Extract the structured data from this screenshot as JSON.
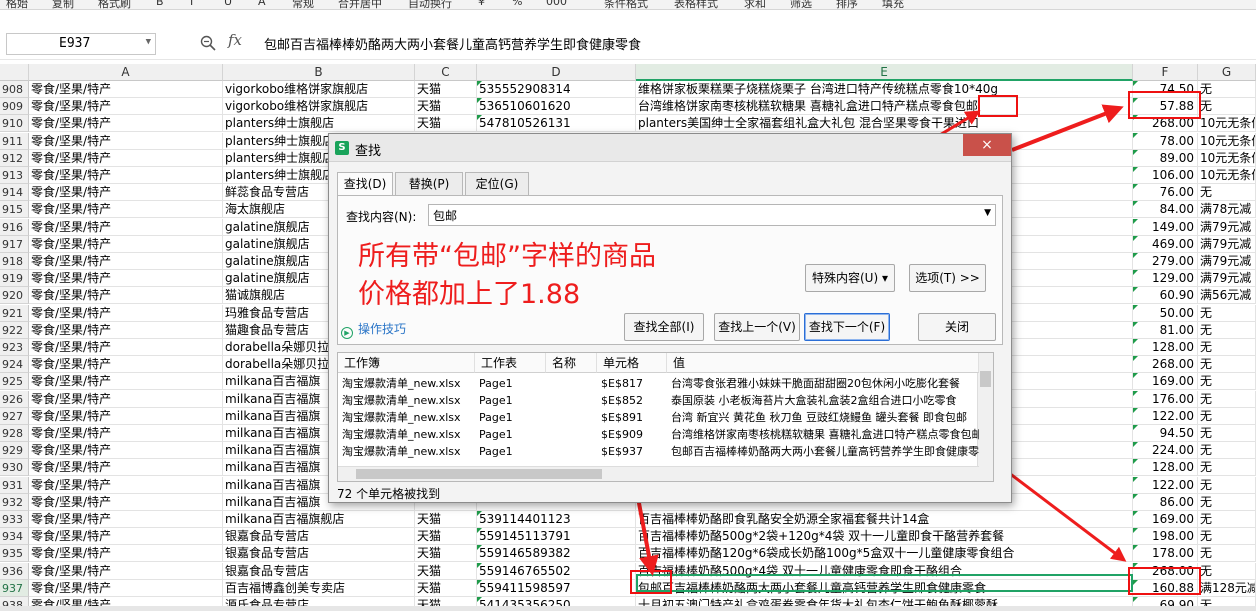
{
  "toolbar": {
    "items": [
      "格始",
      "复制",
      "格式刷",
      "B",
      "I",
      "U",
      "A",
      "常规",
      "合并居中",
      "自动换行",
      "¥",
      "%",
      "000",
      "条件格式",
      "表格样式",
      "求和",
      "筛选",
      "排序",
      "填充"
    ]
  },
  "formula_bar": {
    "name_box": "E937",
    "fx_label": "fx",
    "content": "包邮百吉福棒棒奶酪两大两小套餐儿童高钙营养学生即食健康零食"
  },
  "columns": [
    "A",
    "B",
    "C",
    "D",
    "E",
    "F",
    "G"
  ],
  "rows": [
    {
      "num": "908",
      "a": "零食/坚果/特产",
      "b": "vigorkobo维格饼家旗舰店",
      "c": "天猫",
      "d": "535552908314",
      "e": "维格饼家板栗糕栗子烧糕烧栗子 台湾进口特产传统糕点零食10*40g",
      "f": "74.50",
      "g": "无"
    },
    {
      "num": "909",
      "a": "零食/坚果/特产",
      "b": "vigorkobo维格饼家旗舰店",
      "c": "天猫",
      "d": "536510601620",
      "e": "台湾维格饼家南枣核桃糕软糖果 喜糖礼盒进口特产糕点零食包邮",
      "f": "57.88",
      "g": "无"
    },
    {
      "num": "910",
      "a": "零食/坚果/特产",
      "b": "planters绅士旗舰店",
      "c": "天猫",
      "d": "547810526131",
      "e": "planters美国绅士全家福套组礼盒大礼包 混合坚果零食干果进口",
      "f": "268.00",
      "g": "10元无条件"
    },
    {
      "num": "911",
      "a": "零食/坚果/特产",
      "b": "planters绅士旗舰店",
      "c": "",
      "d": "",
      "e": "食",
      "f": "78.00",
      "g": "10元无条件"
    },
    {
      "num": "912",
      "a": "零食/坚果/特产",
      "b": "planters绅士旗舰店",
      "c": "",
      "d": "",
      "e": "",
      "f": "89.00",
      "g": "10元无条件"
    },
    {
      "num": "913",
      "a": "零食/坚果/特产",
      "b": "planters绅士旗舰店",
      "c": "",
      "d": "",
      "e": "",
      "f": "106.00",
      "g": "10元无条件"
    },
    {
      "num": "914",
      "a": "零食/坚果/特产",
      "b": "鲜蕊食品专营店",
      "c": "",
      "d": "",
      "e": "",
      "f": "76.00",
      "g": "无"
    },
    {
      "num": "915",
      "a": "零食/坚果/特产",
      "b": "海太旗舰店",
      "c": "",
      "d": "",
      "e": "",
      "f": "84.00",
      "g": "满78元减"
    },
    {
      "num": "916",
      "a": "零食/坚果/特产",
      "b": "galatine旗舰店",
      "c": "",
      "d": "",
      "e": "",
      "f": "149.00",
      "g": "满79元减"
    },
    {
      "num": "917",
      "a": "零食/坚果/特产",
      "b": "galatine旗舰店",
      "c": "",
      "d": "",
      "e": "包",
      "f": "469.00",
      "g": "满79元减"
    },
    {
      "num": "918",
      "a": "零食/坚果/特产",
      "b": "galatine旗舰店",
      "c": "",
      "d": "",
      "e": "包",
      "f": "279.00",
      "g": "满79元减"
    },
    {
      "num": "919",
      "a": "零食/坚果/特产",
      "b": "galatine旗舰店",
      "c": "",
      "d": "",
      "e": "包",
      "f": "129.00",
      "g": "满79元减"
    },
    {
      "num": "920",
      "a": "零食/坚果/特产",
      "b": "猫诚旗舰店",
      "c": "",
      "d": "",
      "e": "肉",
      "f": "60.90",
      "g": "满56元减"
    },
    {
      "num": "921",
      "a": "零食/坚果/特产",
      "b": "玛雅食品专营店",
      "c": "",
      "d": "",
      "e": "食",
      "f": "50.00",
      "g": "无"
    },
    {
      "num": "922",
      "a": "零食/坚果/特产",
      "b": "猫趣食品专营店",
      "c": "",
      "d": "",
      "e": "食",
      "f": "81.00",
      "g": "无"
    },
    {
      "num": "923",
      "a": "零食/坚果/特产",
      "b": "dorabella朵娜贝拉",
      "c": "",
      "d": "",
      "e": "",
      "f": "128.00",
      "g": "无"
    },
    {
      "num": "924",
      "a": "零食/坚果/特产",
      "b": "dorabella朵娜贝拉",
      "c": "",
      "d": "",
      "e": "友",
      "f": "268.00",
      "g": "无"
    },
    {
      "num": "925",
      "a": "零食/坚果/特产",
      "b": "milkana百吉福旗",
      "c": "",
      "d": "",
      "e": "",
      "f": "169.00",
      "g": "无"
    },
    {
      "num": "926",
      "a": "零食/坚果/特产",
      "b": "milkana百吉福旗",
      "c": "",
      "d": "",
      "e": "装",
      "f": "176.00",
      "g": "无"
    },
    {
      "num": "927",
      "a": "零食/坚果/特产",
      "b": "milkana百吉福旗",
      "c": "",
      "d": "",
      "e": "",
      "f": "122.00",
      "g": "无"
    },
    {
      "num": "928",
      "a": "零食/坚果/特产",
      "b": "milkana百吉福旗",
      "c": "",
      "d": "",
      "e": "",
      "f": "94.50",
      "g": "无"
    },
    {
      "num": "929",
      "a": "零食/坚果/特产",
      "b": "milkana百吉福旗",
      "c": "",
      "d": "",
      "e": "",
      "f": "224.00",
      "g": "无"
    },
    {
      "num": "930",
      "a": "零食/坚果/特产",
      "b": "milkana百吉福旗",
      "c": "",
      "d": "",
      "e": "",
      "f": "128.00",
      "g": "无"
    },
    {
      "num": "931",
      "a": "零食/坚果/特产",
      "b": "milkana百吉福旗",
      "c": "",
      "d": "",
      "e": "",
      "f": "122.00",
      "g": "无"
    },
    {
      "num": "932",
      "a": "零食/坚果/特产",
      "b": "milkana百吉福旗",
      "c": "",
      "d": "",
      "e": "",
      "f": "86.00",
      "g": "无"
    },
    {
      "num": "933",
      "a": "零食/坚果/特产",
      "b": "milkana百吉福旗舰店",
      "c": "天猫",
      "d": "539114401123",
      "e": "百吉福棒棒奶酪即食乳酪安全奶源全家福套餐共计14盒",
      "f": "169.00",
      "g": "无"
    },
    {
      "num": "934",
      "a": "零食/坚果/特产",
      "b": "银嘉食品专营店",
      "c": "天猫",
      "d": "559145113791",
      "e": "百吉福棒棒奶酪500g*2袋+120g*4袋 双十一儿童即食干酪营养套餐",
      "f": "198.00",
      "g": "无"
    },
    {
      "num": "935",
      "a": "零食/坚果/特产",
      "b": "银嘉食品专营店",
      "c": "天猫",
      "d": "559146589382",
      "e": "百吉福棒棒奶酪120g*6袋成长奶酪100g*5盒双十一儿童健康零食组合",
      "f": "178.00",
      "g": "无"
    },
    {
      "num": "936",
      "a": "零食/坚果/特产",
      "b": "银嘉食品专营店",
      "c": "天猫",
      "d": "559146765502",
      "e": "百吉福棒棒奶酪500g*4袋 双十一儿童健康零食即食干酪组合",
      "f": "268.00",
      "g": "无"
    },
    {
      "num": "937",
      "a": "零食/坚果/特产",
      "b": "百吉福博鑫创美专卖店",
      "c": "天猫",
      "d": "559411598597",
      "e": "包邮百吉福棒棒奶酪两大两小套餐儿童高钙营养学生即食健康零食",
      "f": "160.88",
      "g": "满128元减"
    },
    {
      "num": "938",
      "a": "零食/坚果/特产",
      "b": "源氏食品专营店",
      "c": "天猫",
      "d": "541435356250",
      "e": "十月初五澳门特产礼盒鸡蛋卷零食年货大礼包杏仁饼干鲍鱼酥椰蓉酥",
      "f": "69.90",
      "g": "无"
    }
  ],
  "dialog": {
    "title": "查找",
    "close": "×",
    "tabs": [
      "查找(D)",
      "替换(P)",
      "定位(G)"
    ],
    "find_label": "查找内容(N):",
    "find_value": "包邮",
    "special_btn": "特殊内容(U) ▾",
    "options_btn": "选项(T) >>",
    "tips": "操作技巧",
    "find_all": "查找全部(I)",
    "find_prev": "查找上一个(V)",
    "find_next": "查找下一个(F)",
    "close_btn": "关闭",
    "result_headers": [
      "工作簿",
      "工作表",
      "名称",
      "单元格",
      "值"
    ],
    "results": [
      {
        "book": "淘宝爆款清单_new.xlsx",
        "sheet": "Page1",
        "name": "",
        "cell": "$E$817",
        "value": "台湾零食张君雅小妹妹干脆面甜甜圈20包休闲小吃膨化套餐"
      },
      {
        "book": "淘宝爆款清单_new.xlsx",
        "sheet": "Page1",
        "name": "",
        "cell": "$E$852",
        "value": "泰国原装 小老板海苔片大盒装礼盒装2盒组合进口小吃零食"
      },
      {
        "book": "淘宝爆款清单_new.xlsx",
        "sheet": "Page1",
        "name": "",
        "cell": "$E$891",
        "value": "台湾 新宜兴 黄花鱼 秋刀鱼 豆豉红烧鳗鱼 罐头套餐 即食包邮"
      },
      {
        "book": "淘宝爆款清单_new.xlsx",
        "sheet": "Page1",
        "name": "",
        "cell": "$E$909",
        "value": "台湾维格饼家南枣核桃糕软糖果 喜糖礼盒进口特产糕点零食包邮"
      },
      {
        "book": "淘宝爆款清单_new.xlsx",
        "sheet": "Page1",
        "name": "",
        "cell": "$E$937",
        "value": "包邮百吉福棒棒奶酪两大两小套餐儿童高钙营养学生即食健康零食"
      }
    ],
    "status": "72 个单元格被找到"
  },
  "annotation": {
    "line1": "所有带“包邮”字样的商品",
    "line2": "价格都加上了1.88",
    "color": "#ee1d1d"
  },
  "colors": {
    "accent": "#21a366",
    "highlight": "#ee1d1d",
    "dialog_close": "#c9514a"
  }
}
